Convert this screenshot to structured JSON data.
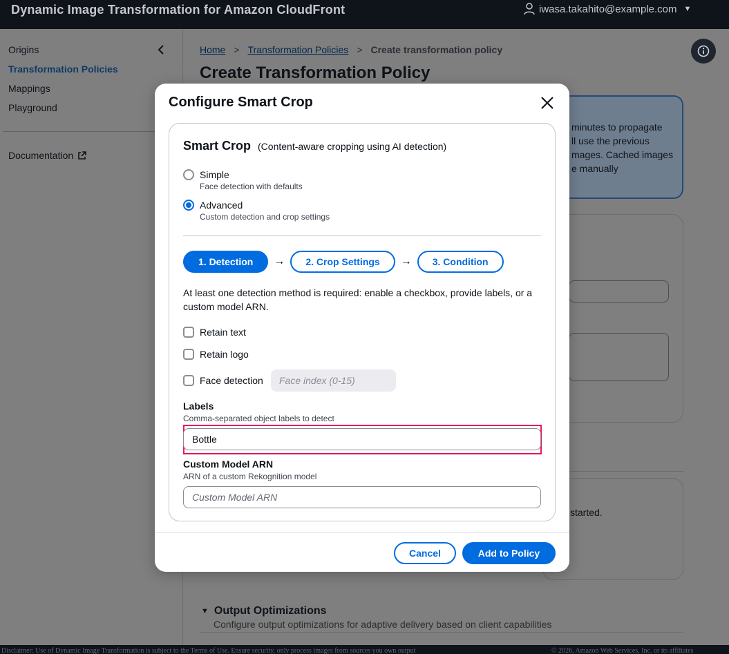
{
  "topbar": {
    "title": "Dynamic Image Transformation for Amazon CloudFront",
    "user": "iwasa.takahito@example.com",
    "user_icon": "user-icon",
    "caret": "▼"
  },
  "sidebar": {
    "items": [
      {
        "label": "Origins"
      },
      {
        "label": "Transformation Policies",
        "active": true
      },
      {
        "label": "Mappings"
      },
      {
        "label": "Playground"
      }
    ],
    "documentation": "Documentation"
  },
  "breadcrumb": {
    "home": "Home",
    "policies": "Transformation Policies",
    "current": "Create transformation policy",
    "separator": ">"
  },
  "page": {
    "title": "Create Transformation Policy",
    "alert_lines": [
      "minutes to propagate",
      "ll use the previous",
      "mages. Cached images",
      "e manually"
    ],
    "started_text": "started.",
    "output_heading": "Output Optimizations",
    "output_desc": "Configure output optimizations for adaptive delivery based on client capabilities"
  },
  "footer": {
    "left": "Disclaimer: Use of Dynamic Image Transformation is subject to the Terms of Use. Ensure security, only process images from sources you own output",
    "right": "© 2026, Amazon Web Services, Inc. or its affiliates"
  },
  "modal": {
    "title": "Configure Smart Crop",
    "section_title": "Smart Crop",
    "section_desc": "(Content-aware cropping using AI detection)",
    "mode_options": [
      {
        "label": "Simple",
        "desc": "Face detection with defaults",
        "checked": false
      },
      {
        "label": "Advanced",
        "desc": "Custom detection and crop settings",
        "checked": true
      }
    ],
    "steps": [
      {
        "label": "1. Detection",
        "active": true
      },
      {
        "label": "2. Crop Settings",
        "active": false
      },
      {
        "label": "3. Condition",
        "active": false
      }
    ],
    "step_arrow": "→",
    "help_text": "At least one detection method is required: enable a checkbox, provide labels, or a custom model ARN.",
    "checkboxes": [
      {
        "label": "Retain text",
        "checked": false
      },
      {
        "label": "Retain logo",
        "checked": false
      },
      {
        "label": "Face detection",
        "checked": false
      }
    ],
    "face_index_placeholder": "Face index (0-15)",
    "labels": {
      "label": "Labels",
      "desc": "Comma-separated object labels to detect",
      "value": "Bottle"
    },
    "custom_model": {
      "label": "Custom Model ARN",
      "desc": "ARN of a custom Rekognition model",
      "placeholder": "Custom Model ARN"
    },
    "cancel": "Cancel",
    "submit": "Add to Policy"
  },
  "colors": {
    "primary": "#006ce0",
    "highlight": "#e6175f",
    "topbar": "#0f141a"
  }
}
